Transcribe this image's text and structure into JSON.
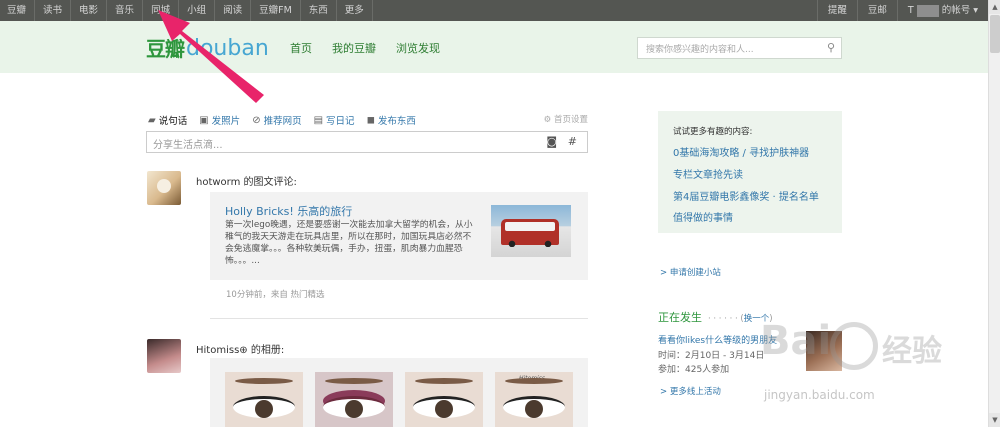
{
  "topnav": {
    "items": [
      "豆瓣",
      "读书",
      "电影",
      "音乐",
      "同城",
      "小组",
      "阅读",
      "豆瓣FM",
      "东西",
      "更多"
    ],
    "right": {
      "remind": "提醒",
      "doumail": "豆邮",
      "account_prefix": "T",
      "account_suffix": "的帐号 ▾"
    }
  },
  "header": {
    "logo_cn": "豆瓣",
    "logo_en": "douban",
    "nav": [
      "首页",
      "我的豆瓣",
      "浏览发现"
    ],
    "search_placeholder": "搜索你感兴趣的内容和人..."
  },
  "composer": {
    "tabs": [
      {
        "icon": "speech-bubble-icon",
        "label": "说句话"
      },
      {
        "icon": "photo-icon",
        "label": "发照片"
      },
      {
        "icon": "link-icon",
        "label": "推荐网页"
      },
      {
        "icon": "notebook-icon",
        "label": "写日记"
      },
      {
        "icon": "bag-icon",
        "label": "发布东西"
      }
    ],
    "settings": "首页设置",
    "placeholder": "分享生活点滴..."
  },
  "feed": [
    {
      "user": "hotworm",
      "action": " 的图文评论:",
      "card_title": "Holly Bricks! 乐高的旅行",
      "excerpt": "第一次lego晚遇，还是要感谢一次能去加拿大留学的机会，从小稚气的我天天游走在玩具店里，所以在那时，加国玩具店必然不会免逃魔掌。。。各种软美玩偶，手办，扭蛋，肌肉暴力血腥恐怖。。。...",
      "meta": "10分钟前，来自 热门精选"
    },
    {
      "user": "Hitomiss⊕",
      "action": " 的相册:",
      "watermark": "Hitomiss"
    }
  ],
  "sidebar": {
    "box_heading": "试试更多有趣的内容:",
    "links": [
      "0基础海淘攻略 / 寻找护肤神器",
      "专栏文章抢先读",
      "第4届豆瓣电影鑫像奖 · 提名名单",
      "值得做的事情"
    ],
    "create_site": "> 申请创建小站",
    "happening_title": "正在发生",
    "happening_dots": "· · · · · ·",
    "happening_switch": "换一个",
    "event_title": "看看你likes什么等级的男朋友",
    "event_time": "时间：2月10日 - 3月14日",
    "event_join": "参加：425人参加",
    "more_events": "> 更多线上活动"
  },
  "watermark": {
    "big": "Bai",
    "cn": "经验",
    "url": "jingyan.baidu.com"
  },
  "colors": {
    "topbar": "#545652",
    "header": "#e9f4e9",
    "link": "#3377aa",
    "green": "#2e963d",
    "arrow": "#e8246a"
  }
}
